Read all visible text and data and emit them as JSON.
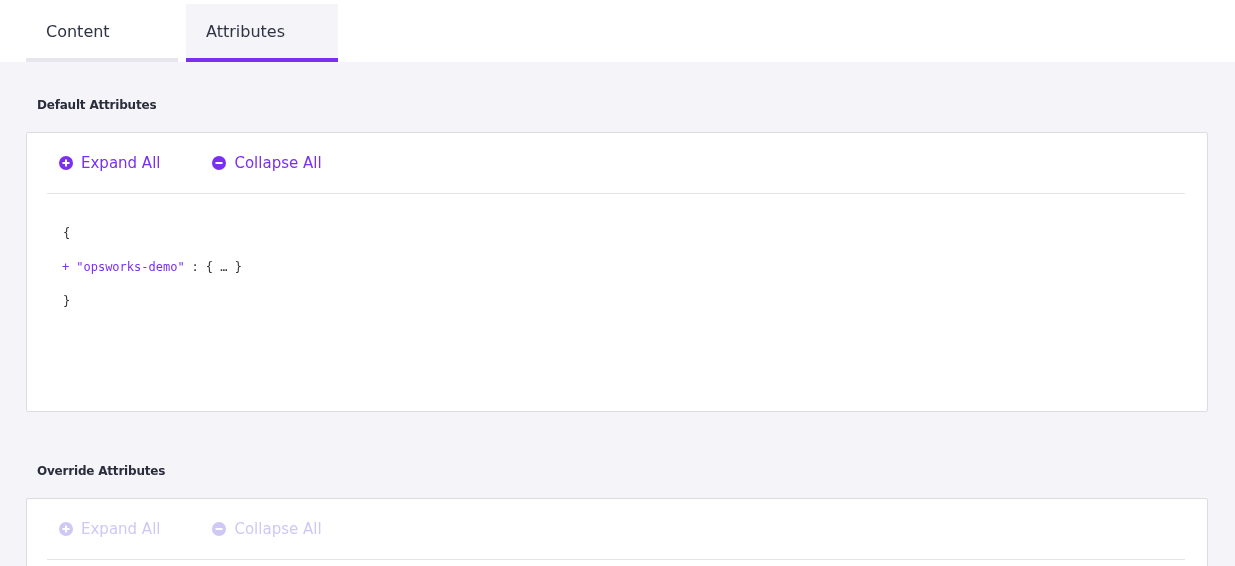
{
  "tabs": [
    {
      "label": "Content",
      "selected": false
    },
    {
      "label": "Attributes",
      "selected": true
    }
  ],
  "sections": [
    {
      "title": "Default Attributes",
      "disabled": false,
      "buttons": [
        {
          "kind": "expand",
          "label": "Expand All"
        },
        {
          "kind": "collapse",
          "label": "Collapse All"
        }
      ],
      "code": [
        {
          "kind": "brace",
          "text": "{"
        },
        {
          "kind": "entry",
          "toggle": "+",
          "key": "\"opsworks-demo\"",
          "sep": ":",
          "value": "{ … }"
        },
        {
          "kind": "brace",
          "text": "}"
        }
      ]
    },
    {
      "title": "Override Attributes",
      "disabled": true,
      "buttons": [
        {
          "kind": "expand",
          "label": "Expand All"
        },
        {
          "kind": "collapse",
          "label": "Collapse All"
        }
      ]
    }
  ]
}
